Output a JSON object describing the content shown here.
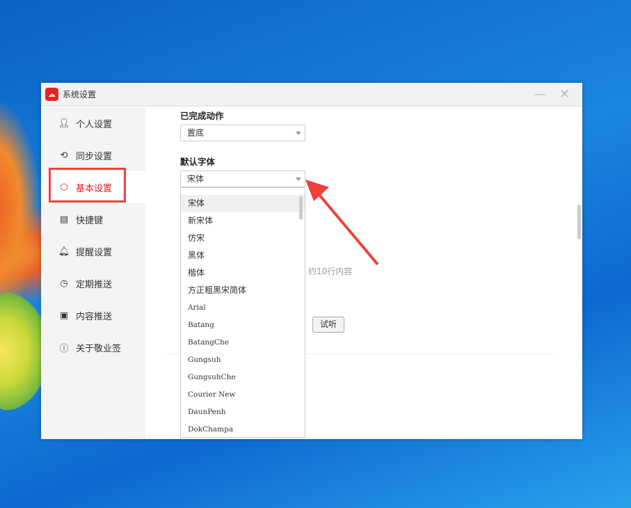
{
  "window": {
    "title": "系统设置",
    "logo_icon": "cloud-logo-icon"
  },
  "sidebar": {
    "items": [
      {
        "label": "个人设置",
        "icon": "user-icon"
      },
      {
        "label": "同步设置",
        "icon": "sync-icon"
      },
      {
        "label": "基本设置",
        "icon": "hexagon-icon",
        "active": true
      },
      {
        "label": "快捷键",
        "icon": "keyboard-icon"
      },
      {
        "label": "提醒设置",
        "icon": "bell-icon"
      },
      {
        "label": "定期推送",
        "icon": "clock-icon"
      },
      {
        "label": "内容推送",
        "icon": "document-icon"
      },
      {
        "label": "关于敬业签",
        "icon": "info-icon"
      }
    ]
  },
  "main": {
    "completed_action": {
      "label": "已完成动作",
      "value": "置底"
    },
    "default_font": {
      "label": "默认字体",
      "value": "宋体",
      "options": [
        "宋体",
        "新宋体",
        "仿宋",
        "黑体",
        "楷体",
        "方正粗黑宋简体",
        "Arial",
        "Batang",
        "BatangChe",
        "Gungsuh",
        "GungsuhChe",
        "Courier New",
        "DaunPenh",
        "DokChampa"
      ]
    },
    "hint": "约10行内容",
    "listen_button": "试听"
  },
  "colors": {
    "accent": "#e02020",
    "annotation": "#f0403a"
  }
}
